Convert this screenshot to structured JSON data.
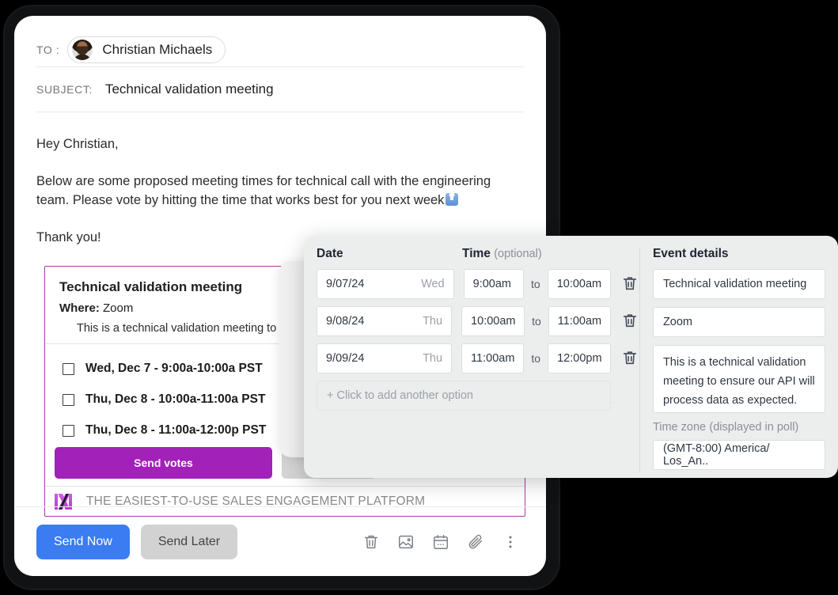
{
  "compose": {
    "to_label": "TO :",
    "recipient": "Christian Michaels",
    "subject_label": "SUBJECT:",
    "subject_value": "Technical validation meeting",
    "greeting": "Hey Christian,",
    "paragraph": "Below are some proposed meeting times for technical call with the engineering team.  Please vote by hitting the time that works best for you next week",
    "signoff": "Thank you!"
  },
  "poll_card": {
    "title": "Technical validation meeting",
    "where_label": "Where:",
    "where_value": "Zoom",
    "description": "This is a technical validation meeting to ensure our API",
    "options": [
      "Wed, Dec 7 - 9:00a-10:00a PST",
      "Thu, Dec 8 - 10:00a-11:00a PST",
      "Thu, Dec 8 - 11:00a-12:00p PST"
    ],
    "send_votes_label": "Send votes",
    "footer_tagline": "THE EASIEST-TO-USE SALES ENGAGEMENT PLATFORM",
    "accent_color": "#a221b8",
    "border_color": "#a13fa1"
  },
  "toolbar": {
    "send_now_label": "Send Now",
    "send_later_label": "Send Later",
    "send_now_color": "#3b7cf3",
    "icons": [
      "trash-icon",
      "image-icon",
      "calendar-icon",
      "paperclip-icon",
      "more-vertical-icon"
    ]
  },
  "popup": {
    "date_header": "Date",
    "time_header": "Time",
    "time_header_sub": "(optional)",
    "to_word": "to",
    "rows": [
      {
        "date": "9/07/24",
        "dow": "Wed",
        "start": "9:00am",
        "end": "10:00am"
      },
      {
        "date": "9/08/24",
        "dow": "Thu",
        "start": "10:00am",
        "end": "11:00am"
      },
      {
        "date": "9/09/24",
        "dow": "Thu",
        "start": "11:00am",
        "end": "12:00pm"
      }
    ],
    "add_option_label": "+ Click to add another option",
    "event_details": {
      "header": "Event details",
      "title_value": "Technical validation meeting",
      "location_value": "Zoom",
      "description_value": "This is a technical validation meeting to ensure our API will process data as expected.",
      "timezone_label": "Time zone",
      "timezone_sub": "(displayed in poll)",
      "timezone_value": "(GMT-8:00) America/ Los_An.."
    }
  }
}
